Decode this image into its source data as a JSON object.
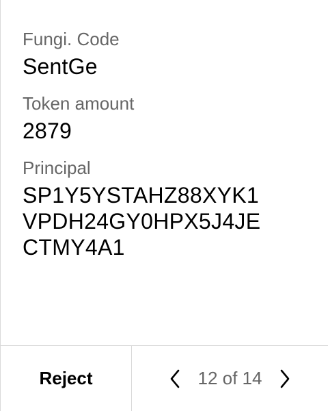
{
  "fields": {
    "code": {
      "label": "Fungi. Code",
      "value": "SentGe"
    },
    "amount": {
      "label": "Token amount",
      "value": "2879"
    },
    "principal": {
      "label": "Principal",
      "lines": [
        "SP1Y5YSTAHZ88XYK1",
        "VPDH24GY0HPX5J4JE",
        "CTMY4A1"
      ]
    }
  },
  "footer": {
    "reject_label": "Reject",
    "page_indicator": "12 of 14",
    "prev_icon": "chevron-left",
    "next_icon": "chevron-right"
  }
}
